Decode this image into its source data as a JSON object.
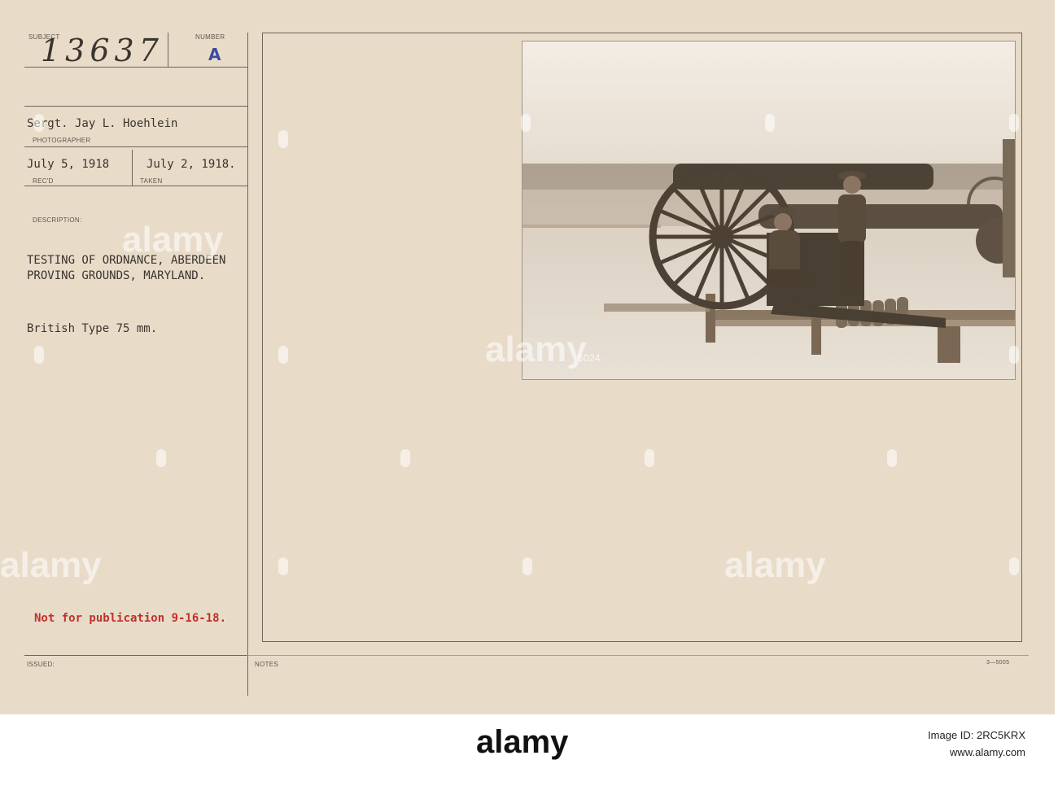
{
  "card": {
    "subject_label": "SUBJECT",
    "subject_number": "13637",
    "number_label": "NUMBER",
    "number_value": "A",
    "photographer": "Sergt. Jay L. Hoehlein",
    "photographer_label": "PHOTOGRAPHER",
    "received_date": "July 5, 1918",
    "received_label": "REC'D",
    "taken_date": "July 2, 1918.",
    "taken_label": "TAKEN",
    "description_label": "DESCRIPTION:",
    "description_line1": "TESTING OF ORDNANCE, ABERDEEN",
    "description_line2": "PROVING GROUNDS, MARYLAND.",
    "description_line3": "British Type 75 mm.",
    "publication_note": "Not for publication 9-16-18.",
    "issued_label": "ISSUED:",
    "notes_label": "NOTES",
    "form_code": "3—5005"
  },
  "photo": {
    "negative_mark": "5024"
  },
  "watermark": {
    "text": "alamy"
  },
  "footer": {
    "logo": "alamy",
    "image_id": "Image ID: 2RC5KRX",
    "site": "www.alamy.com"
  },
  "colors": {
    "card": "#e8dcc9",
    "red_stamp": "#c2302c",
    "blue_stamp": "#3b4aa0"
  }
}
